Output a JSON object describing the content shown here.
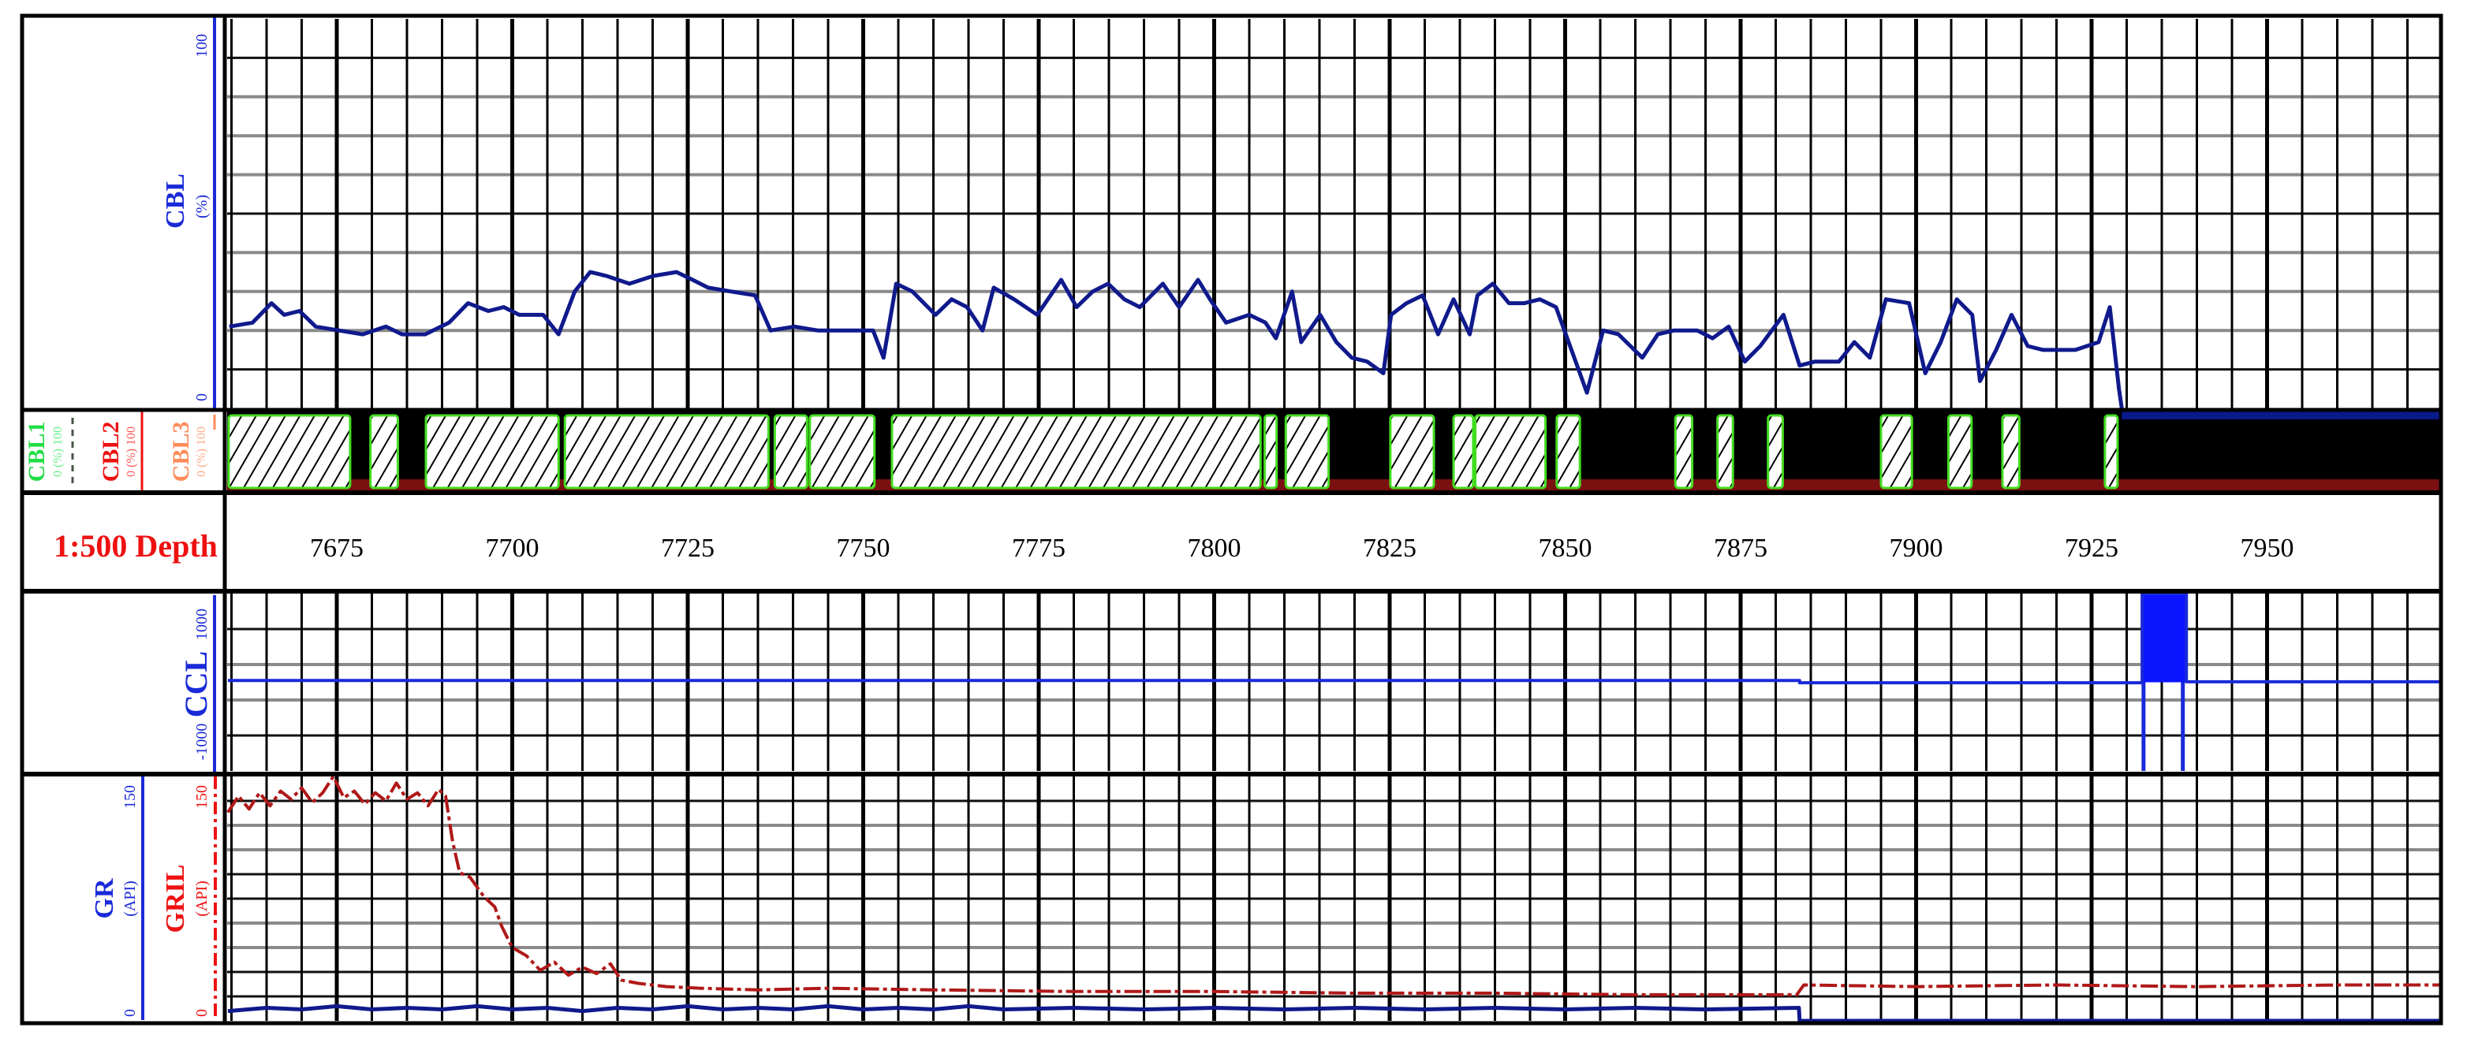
{
  "header": {
    "cbl": {
      "name": "CBL",
      "unit": "(%)",
      "min": "0",
      "max": "100"
    },
    "cbl1": {
      "name": "CBL1",
      "scale": "0 (%) 100"
    },
    "cbl2": {
      "name": "CBL2",
      "scale": "0 (%) 100"
    },
    "cbl3": {
      "name": "CBL3",
      "scale": "0 (%) 100"
    },
    "depth_title": "1:500 Depth",
    "ccl": {
      "name": "CCL",
      "min": "-1000",
      "max": "1000"
    },
    "gr": {
      "name": "GR",
      "unit": "(API)",
      "min": "0",
      "max": "150"
    },
    "gril": {
      "name": "GRIL",
      "unit": "(API)",
      "min": "0",
      "max": "150"
    }
  },
  "colors": {
    "cbl": "#101a8c",
    "cbl_axis": "#1a2ad8",
    "cbl1": "#22dd44",
    "cbl2": "#ee1111",
    "cbl3": "#ff8c5a",
    "ccl": "#1a2ad8",
    "ccl_fill": "#0a14ff",
    "gr": "#101a8c",
    "gril": "#b01818",
    "depth_title": "#ee1111",
    "bond_background": "#000000",
    "bond_bottom": "#7a1010",
    "bond_edge": "#44dd22"
  },
  "chart_data": {
    "type": "line",
    "title": "Cement bond log, scale 1:500",
    "depth_range": [
      7659.5,
      7974.5
    ],
    "depth_ticks": [
      7675,
      7700,
      7725,
      7750,
      7775,
      7800,
      7825,
      7850,
      7875,
      7900,
      7925,
      7950
    ],
    "grid": true,
    "cbl": {
      "name": "CBL",
      "unit": "%",
      "range": [
        0,
        100
      ],
      "points": [
        [
          7659.7,
          21
        ],
        [
          7663.0,
          22
        ],
        [
          7665.7,
          27
        ],
        [
          7667.5,
          24
        ],
        [
          7669.7,
          25
        ],
        [
          7672.0,
          21
        ],
        [
          7675.3,
          20
        ],
        [
          7678.7,
          19
        ],
        [
          7682.0,
          21
        ],
        [
          7684.3,
          19
        ],
        [
          7687.6,
          19
        ],
        [
          7691.0,
          22
        ],
        [
          7693.7,
          27
        ],
        [
          7696.6,
          25
        ],
        [
          7698.8,
          26
        ],
        [
          7701.0,
          24
        ],
        [
          7704.4,
          24
        ],
        [
          7706.6,
          19
        ],
        [
          7708.9,
          30
        ],
        [
          7711.1,
          35
        ],
        [
          7713.4,
          34
        ],
        [
          7716.7,
          32
        ],
        [
          7720.1,
          34
        ],
        [
          7723.4,
          35
        ],
        [
          7725.7,
          33
        ],
        [
          7727.9,
          31
        ],
        [
          7731.2,
          30
        ],
        [
          7734.6,
          29
        ],
        [
          7736.8,
          20
        ],
        [
          7740.2,
          21
        ],
        [
          7743.5,
          20
        ],
        [
          7748.0,
          20
        ],
        [
          7751.4,
          20
        ],
        [
          7752.9,
          13
        ],
        [
          7754.7,
          32
        ],
        [
          7757.0,
          30
        ],
        [
          7760.3,
          24
        ],
        [
          7762.6,
          28
        ],
        [
          7764.8,
          26
        ],
        [
          7767.0,
          20
        ],
        [
          7768.6,
          31
        ],
        [
          7771.5,
          28
        ],
        [
          7774.8,
          24
        ],
        [
          7778.2,
          33
        ],
        [
          7780.4,
          26
        ],
        [
          7782.7,
          30
        ],
        [
          7784.9,
          32
        ],
        [
          7787.2,
          28
        ],
        [
          7789.4,
          26
        ],
        [
          7792.7,
          32
        ],
        [
          7795.0,
          26
        ],
        [
          7797.7,
          33
        ],
        [
          7799.4,
          28
        ],
        [
          7801.7,
          22
        ],
        [
          7805.0,
          24
        ],
        [
          7807.3,
          22
        ],
        [
          7808.8,
          18
        ],
        [
          7811.1,
          30
        ],
        [
          7812.4,
          17
        ],
        [
          7815.1,
          24
        ],
        [
          7817.4,
          17
        ],
        [
          7819.6,
          13
        ],
        [
          7821.8,
          12
        ],
        [
          7824.1,
          9
        ],
        [
          7825.2,
          24
        ],
        [
          7827.4,
          27
        ],
        [
          7829.7,
          29
        ],
        [
          7831.9,
          19
        ],
        [
          7834.1,
          28
        ],
        [
          7836.4,
          19
        ],
        [
          7837.5,
          29
        ],
        [
          7839.7,
          32
        ],
        [
          7842.0,
          27
        ],
        [
          7844.2,
          27
        ],
        [
          7846.4,
          28
        ],
        [
          7848.7,
          26
        ],
        [
          7850.9,
          15
        ],
        [
          7853.1,
          4
        ],
        [
          7855.4,
          20
        ],
        [
          7857.6,
          19
        ],
        [
          7861.0,
          13
        ],
        [
          7863.2,
          19
        ],
        [
          7865.5,
          20
        ],
        [
          7868.8,
          20
        ],
        [
          7871.0,
          18
        ],
        [
          7873.3,
          21
        ],
        [
          7875.6,
          12
        ],
        [
          7877.8,
          16
        ],
        [
          7881.1,
          24
        ],
        [
          7883.4,
          11
        ],
        [
          7885.6,
          12
        ],
        [
          7889.0,
          12
        ],
        [
          7891.2,
          17
        ],
        [
          7893.4,
          13
        ],
        [
          7895.7,
          28
        ],
        [
          7899.0,
          27
        ],
        [
          7901.3,
          9
        ],
        [
          7903.5,
          17
        ],
        [
          7905.8,
          28
        ],
        [
          7908.0,
          24
        ],
        [
          7909.1,
          7
        ],
        [
          7911.4,
          15
        ],
        [
          7913.6,
          24
        ],
        [
          7915.9,
          16
        ],
        [
          7918.1,
          15
        ],
        [
          7922.7,
          15
        ],
        [
          7926.0,
          17
        ],
        [
          7927.6,
          26
        ],
        [
          7928.9,
          5
        ],
        [
          7929.3,
          0
        ]
      ]
    },
    "bond": {
      "legend": [
        "CBL1",
        "CBL2",
        "CBL3"
      ],
      "bonded_intervals_hatched": [
        [
          7659.6,
          7676.9
        ],
        [
          7679.8,
          7683.7
        ],
        [
          7687.7,
          7706.6
        ],
        [
          7707.5,
          7736.5
        ],
        [
          7737.4,
          7742.0
        ],
        [
          7742.4,
          7751.6
        ],
        [
          7754.1,
          7806.6
        ],
        [
          7807.2,
          7808.9
        ],
        [
          7810.2,
          7816.3
        ],
        [
          7825.1,
          7831.3
        ],
        [
          7834.1,
          7836.9
        ],
        [
          7837.2,
          7847.2
        ],
        [
          7848.8,
          7852.1
        ],
        [
          7865.7,
          7868.1
        ],
        [
          7871.7,
          7873.9
        ],
        [
          7878.9,
          7881.0
        ],
        [
          7895.0,
          7899.4
        ],
        [
          7904.6,
          7907.9
        ],
        [
          7912.3,
          7914.7
        ],
        [
          7926.9,
          7928.7
        ]
      ],
      "no_data_from_depth": 7929.3
    },
    "ccl": {
      "name": "CCL",
      "range": [
        -1000,
        1000
      ],
      "points": [
        [
          7659.5,
          20
        ],
        [
          7883.4,
          20
        ],
        [
          7883.4,
          -5
        ],
        [
          7932.2,
          -5
        ],
        [
          7932.2,
          1000
        ],
        [
          7938.5,
          1000
        ],
        [
          7938.5,
          5
        ],
        [
          7974.5,
          5
        ]
      ],
      "filled_interval": [
        7932.2,
        7938.5
      ],
      "spikes": [
        {
          "depth": 7932.4,
          "value": -1000
        },
        {
          "depth": 7938.0,
          "value": -1000
        }
      ]
    },
    "gr": {
      "name": "GR",
      "unit": "API",
      "range": [
        0,
        150
      ],
      "points": [
        [
          7659.5,
          6
        ],
        [
          7665,
          8
        ],
        [
          7670,
          7
        ],
        [
          7675,
          9
        ],
        [
          7680,
          7
        ],
        [
          7685,
          8
        ],
        [
          7690,
          7
        ],
        [
          7695,
          9
        ],
        [
          7700,
          7
        ],
        [
          7705,
          8
        ],
        [
          7710,
          6
        ],
        [
          7715,
          8
        ],
        [
          7720,
          7
        ],
        [
          7725,
          9
        ],
        [
          7730,
          7
        ],
        [
          7735,
          8
        ],
        [
          7740,
          7
        ],
        [
          7745,
          9
        ],
        [
          7750,
          7
        ],
        [
          7755,
          8
        ],
        [
          7760,
          7
        ],
        [
          7765,
          9
        ],
        [
          7770,
          7
        ],
        [
          7780,
          8
        ],
        [
          7790,
          7
        ],
        [
          7800,
          8
        ],
        [
          7810,
          7
        ],
        [
          7820,
          8
        ],
        [
          7830,
          7
        ],
        [
          7840,
          8
        ],
        [
          7850,
          7
        ],
        [
          7860,
          8
        ],
        [
          7870,
          7
        ],
        [
          7883.3,
          8
        ],
        [
          7883.4,
          0
        ],
        [
          7974.5,
          0
        ]
      ]
    },
    "gril": {
      "name": "GRIL",
      "unit": "API",
      "range": [
        0,
        150
      ],
      "points": [
        [
          7659.5,
          128
        ],
        [
          7661,
          138
        ],
        [
          7662.5,
          130
        ],
        [
          7664,
          140
        ],
        [
          7665.5,
          132
        ],
        [
          7667,
          141
        ],
        [
          7668.5,
          136
        ],
        [
          7670,
          143
        ],
        [
          7671.5,
          134
        ],
        [
          7673,
          140
        ],
        [
          7674.5,
          150
        ],
        [
          7676,
          137
        ],
        [
          7677.5,
          141
        ],
        [
          7679,
          133
        ],
        [
          7680.5,
          140
        ],
        [
          7682,
          135
        ],
        [
          7683.5,
          146
        ],
        [
          7685,
          136
        ],
        [
          7686.5,
          140
        ],
        [
          7688,
          132
        ],
        [
          7689.5,
          142
        ],
        [
          7690.5,
          138
        ],
        [
          7691.5,
          110
        ],
        [
          7692.5,
          91
        ],
        [
          7694,
          88
        ],
        [
          7696,
          76
        ],
        [
          7697.5,
          70
        ],
        [
          7698.5,
          58
        ],
        [
          7700,
          45
        ],
        [
          7702,
          40
        ],
        [
          7704,
          31
        ],
        [
          7706,
          36
        ],
        [
          7708,
          28
        ],
        [
          7710,
          33
        ],
        [
          7712,
          29
        ],
        [
          7714,
          35
        ],
        [
          7715.5,
          25
        ],
        [
          7718,
          23
        ],
        [
          7722,
          21
        ],
        [
          7727,
          20
        ],
        [
          7735,
          19
        ],
        [
          7745,
          20
        ],
        [
          7760,
          19
        ],
        [
          7780,
          18
        ],
        [
          7800,
          18
        ],
        [
          7820,
          17
        ],
        [
          7840,
          17
        ],
        [
          7860,
          16
        ],
        [
          7883,
          16
        ],
        [
          7884,
          22
        ],
        [
          7900,
          21
        ],
        [
          7920,
          22
        ],
        [
          7940,
          21
        ],
        [
          7960,
          22
        ],
        [
          7974.5,
          22
        ]
      ]
    }
  }
}
